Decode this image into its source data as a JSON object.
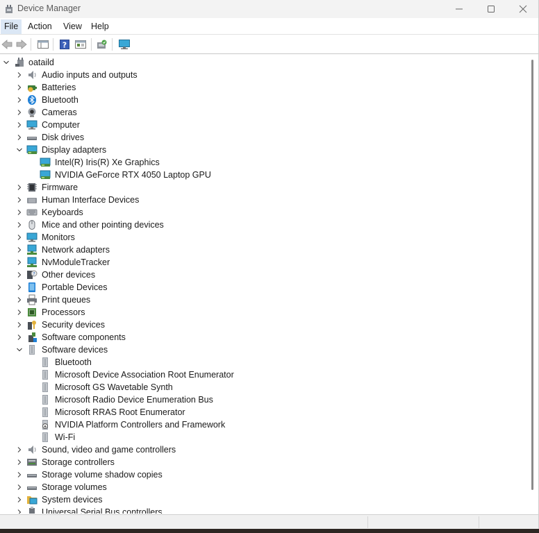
{
  "window": {
    "title": "Device Manager"
  },
  "menu": {
    "items": [
      "File",
      "Action",
      "View",
      "Help"
    ]
  },
  "toolbar": {
    "buttons": [
      "back-arrow-icon",
      "forward-arrow-icon",
      "show-hide-tree-icon",
      "help-icon",
      "properties-icon",
      "scan-hardware-icon",
      "monitor-icon"
    ]
  },
  "tree": {
    "root": "oataild",
    "items": [
      {
        "label": "Audio inputs and outputs",
        "level": 1,
        "state": "collapsed",
        "icon": "speaker-icon"
      },
      {
        "label": "Batteries",
        "level": 1,
        "state": "collapsed",
        "icon": "battery-icon"
      },
      {
        "label": "Bluetooth",
        "level": 1,
        "state": "collapsed",
        "icon": "bluetooth-icon"
      },
      {
        "label": "Cameras",
        "level": 1,
        "state": "collapsed",
        "icon": "camera-icon"
      },
      {
        "label": "Computer",
        "level": 1,
        "state": "collapsed",
        "icon": "computer-icon"
      },
      {
        "label": "Disk drives",
        "level": 1,
        "state": "collapsed",
        "icon": "disk-icon"
      },
      {
        "label": "Display adapters",
        "level": 1,
        "state": "expanded",
        "icon": "display-adapter-icon"
      },
      {
        "label": "Intel(R) Iris(R) Xe Graphics",
        "level": 2,
        "state": "leaf",
        "icon": "display-adapter-icon"
      },
      {
        "label": "NVIDIA GeForce RTX 4050 Laptop GPU",
        "level": 2,
        "state": "leaf",
        "icon": "display-adapter-icon"
      },
      {
        "label": "Firmware",
        "level": 1,
        "state": "collapsed",
        "icon": "chip-icon"
      },
      {
        "label": "Human Interface Devices",
        "level": 1,
        "state": "collapsed",
        "icon": "hid-icon"
      },
      {
        "label": "Keyboards",
        "level": 1,
        "state": "collapsed",
        "icon": "keyboard-icon"
      },
      {
        "label": "Mice and other pointing devices",
        "level": 1,
        "state": "collapsed",
        "icon": "mouse-icon"
      },
      {
        "label": "Monitors",
        "level": 1,
        "state": "collapsed",
        "icon": "monitor-icon"
      },
      {
        "label": "Network adapters",
        "level": 1,
        "state": "collapsed",
        "icon": "network-icon"
      },
      {
        "label": "NvModuleTracker",
        "level": 1,
        "state": "collapsed",
        "icon": "network-icon"
      },
      {
        "label": "Other devices",
        "level": 1,
        "state": "collapsed",
        "icon": "unknown-device-icon"
      },
      {
        "label": "Portable Devices",
        "level": 1,
        "state": "collapsed",
        "icon": "portable-device-icon"
      },
      {
        "label": "Print queues",
        "level": 1,
        "state": "collapsed",
        "icon": "printer-icon"
      },
      {
        "label": "Processors",
        "level": 1,
        "state": "collapsed",
        "icon": "processor-icon"
      },
      {
        "label": "Security devices",
        "level": 1,
        "state": "collapsed",
        "icon": "security-key-icon"
      },
      {
        "label": "Software components",
        "level": 1,
        "state": "collapsed",
        "icon": "software-component-icon"
      },
      {
        "label": "Software devices",
        "level": 1,
        "state": "expanded",
        "icon": "software-device-icon"
      },
      {
        "label": "Bluetooth",
        "level": 2,
        "state": "leaf",
        "icon": "software-device-icon"
      },
      {
        "label": "Microsoft Device Association Root Enumerator",
        "level": 2,
        "state": "leaf",
        "icon": "software-device-icon"
      },
      {
        "label": "Microsoft GS Wavetable Synth",
        "level": 2,
        "state": "leaf",
        "icon": "software-device-icon"
      },
      {
        "label": "Microsoft Radio Device Enumeration Bus",
        "level": 2,
        "state": "leaf",
        "icon": "software-device-icon"
      },
      {
        "label": "Microsoft RRAS Root Enumerator",
        "level": 2,
        "state": "leaf",
        "icon": "software-device-icon"
      },
      {
        "label": "NVIDIA Platform Controllers and Framework",
        "level": 2,
        "state": "leaf",
        "icon": "software-device-download-icon"
      },
      {
        "label": "Wi-Fi",
        "level": 2,
        "state": "leaf",
        "icon": "software-device-icon"
      },
      {
        "label": "Sound, video and game controllers",
        "level": 1,
        "state": "collapsed",
        "icon": "speaker-icon"
      },
      {
        "label": "Storage controllers",
        "level": 1,
        "state": "collapsed",
        "icon": "storage-controller-icon"
      },
      {
        "label": "Storage volume shadow copies",
        "level": 1,
        "state": "collapsed",
        "icon": "disk-icon"
      },
      {
        "label": "Storage volumes",
        "level": 1,
        "state": "collapsed",
        "icon": "disk-icon"
      },
      {
        "label": "System devices",
        "level": 1,
        "state": "collapsed",
        "icon": "system-folder-icon"
      },
      {
        "label": "Universal Serial Bus controllers",
        "level": 1,
        "state": "collapsed",
        "icon": "usb-icon"
      }
    ]
  },
  "colors": {
    "menu_active": "#dbe7f5",
    "accent_blue": "#1e88e5",
    "monitor_teal": "#39a7d6"
  }
}
